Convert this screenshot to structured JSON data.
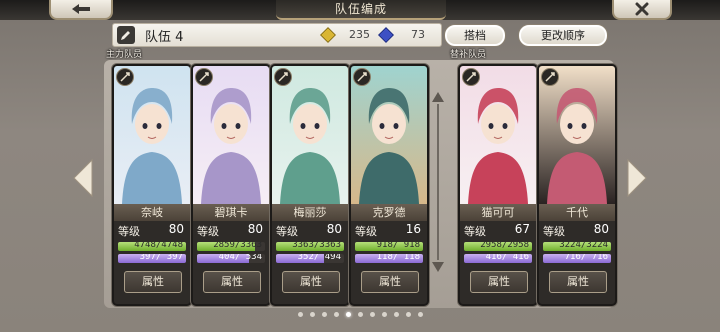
{
  "header": {
    "title": "队伍编成",
    "back_icon": "back-arrow-icon",
    "close_icon": "close-icon"
  },
  "team": {
    "name": "队伍 4",
    "atk_value": "235",
    "def_value": "73",
    "save_label": "搭档",
    "reorder_label": "更改顺序"
  },
  "sections": {
    "main": "主力队员",
    "reserve": "替补队员"
  },
  "cards": [
    {
      "name": "奈岐",
      "level_label": "等级",
      "level": "80",
      "hp": "4748/4748",
      "hp_frac": 1.0,
      "sp": "397/ 397",
      "sp_frac": 1.0,
      "attr_label": "属性",
      "type_icon": "hammer-icon",
      "palette": [
        "#cfe3f0",
        "#7fa9c9",
        "#e9eef5"
      ]
    },
    {
      "name": "碧琪卡",
      "level_label": "等级",
      "level": "80",
      "hp": "2859/3363",
      "hp_frac": 0.85,
      "sp": "404/ 534",
      "sp_frac": 0.76,
      "attr_label": "属性",
      "type_icon": "bow-icon",
      "palette": [
        "#e7dcf3",
        "#a796c9",
        "#f6eef5"
      ]
    },
    {
      "name": "梅丽莎",
      "level_label": "等级",
      "level": "80",
      "hp": "3363/3363",
      "hp_frac": 1.0,
      "sp": "352/ 494",
      "sp_frac": 0.71,
      "attr_label": "属性",
      "type_icon": "sword-icon",
      "palette": [
        "#cfe9e0",
        "#5f9f8d",
        "#e8f2ee"
      ]
    },
    {
      "name": "克罗德",
      "level_label": "等级",
      "level": "16",
      "hp": "918/ 918",
      "hp_frac": 1.0,
      "sp": "118/ 118",
      "sp_frac": 1.0,
      "attr_label": "属性",
      "type_icon": "sword-icon",
      "palette": [
        "#9fd3cf",
        "#3e6b6a",
        "#d7b88a"
      ]
    },
    {
      "name": "猫可可",
      "level_label": "等级",
      "level": "67",
      "hp": "2958/2958",
      "hp_frac": 1.0,
      "sp": "416/ 416",
      "sp_frac": 1.0,
      "attr_label": "属性",
      "type_icon": "hammer-icon",
      "palette": [
        "#f2dce6",
        "#c7425a",
        "#f7f0f2"
      ]
    },
    {
      "name": "千代",
      "level_label": "等级",
      "level": "80",
      "hp": "3224/3224",
      "hp_frac": 1.0,
      "sp": "716/ 716",
      "sp_frac": 1.0,
      "attr_label": "属性",
      "type_icon": "shield-icon",
      "palette": [
        "#f1dfc8",
        "#c45b73",
        "#2a2322"
      ]
    }
  ],
  "pagination": {
    "count": 11,
    "active_index": 4
  },
  "colors": {
    "accent": "#b7a27a",
    "hp": "#8bc34a",
    "sp": "#9c7fe0"
  }
}
